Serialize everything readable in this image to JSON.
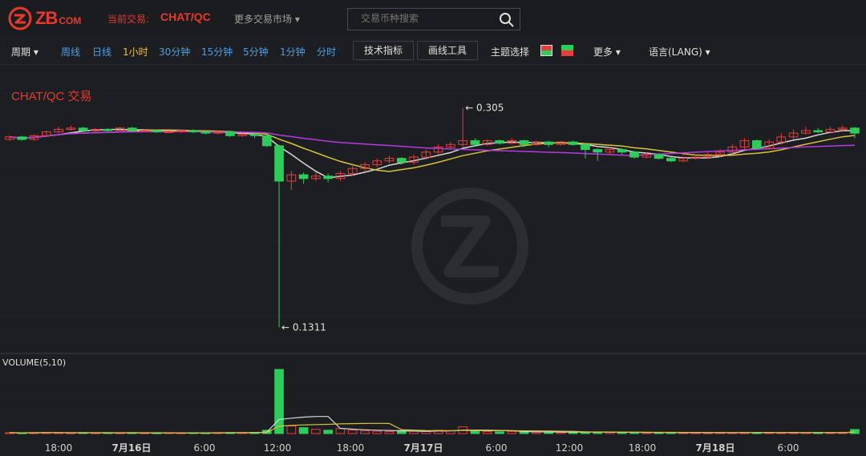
{
  "header": {
    "logo_text": "ZB",
    "logo_sub": "COM",
    "current_label": "当前交易:",
    "current_pair": "CHAT/QC",
    "more_markets": "更多交易市场 ▾",
    "search_placeholder": "交易币种搜索"
  },
  "toolbar": {
    "period": "周期 ▾",
    "intervals": [
      "周线",
      "日线",
      "1小时",
      "30分钟",
      "15分钟",
      "5分钟",
      "1分钟",
      "分时"
    ],
    "active_interval": "1小时",
    "indicators": "技术指标",
    "draw_tools": "画线工具",
    "theme": "主题选择",
    "more": "更多 ▾",
    "language": "语言(LANG) ▾"
  },
  "colors": {
    "up": "#e83d3d",
    "down": "#2ecc5a",
    "ma_white": "#d8d8d8",
    "ma_yellow": "#d9c23a",
    "ma_purple": "#b23adf",
    "accent": "#e63a2f"
  },
  "icons": [
    "zb-logo-icon",
    "search-icon",
    "watermark-logo-icon"
  ],
  "chart_data": {
    "type": "candlestick",
    "title": "CHAT/QC 交易",
    "high_label": "← 0.305",
    "low_label": "← 0.1311",
    "high": 0.305,
    "low": 0.1311,
    "volume_label": "VOLUME(5,10)",
    "x_ticks": [
      "18:00",
      "7月16日",
      "6:00",
      "12:00",
      "18:00",
      "7月17日",
      "6:00",
      "12:00",
      "18:00",
      "7月18日",
      "6:00"
    ],
    "bold_ticks": [
      "7月16日",
      "7月17日",
      "7月18日"
    ],
    "ylim": [
      0.12,
      0.32
    ],
    "candles": [
      [
        0.28,
        0.282,
        0.283,
        0.279
      ],
      [
        0.282,
        0.28,
        0.283,
        0.279
      ],
      [
        0.28,
        0.283,
        0.284,
        0.279
      ],
      [
        0.283,
        0.286,
        0.287,
        0.282
      ],
      [
        0.286,
        0.288,
        0.29,
        0.285
      ],
      [
        0.288,
        0.289,
        0.291,
        0.287
      ],
      [
        0.289,
        0.287,
        0.29,
        0.286
      ],
      [
        0.287,
        0.288,
        0.289,
        0.286
      ],
      [
        0.288,
        0.287,
        0.289,
        0.286
      ],
      [
        0.287,
        0.289,
        0.29,
        0.286
      ],
      [
        0.289,
        0.287,
        0.29,
        0.286
      ],
      [
        0.287,
        0.287,
        0.288,
        0.286
      ],
      [
        0.287,
        0.286,
        0.288,
        0.285
      ],
      [
        0.286,
        0.286,
        0.287,
        0.285
      ],
      [
        0.286,
        0.287,
        0.288,
        0.285
      ],
      [
        0.287,
        0.286,
        0.288,
        0.285
      ],
      [
        0.286,
        0.285,
        0.287,
        0.284
      ],
      [
        0.285,
        0.286,
        0.287,
        0.284
      ],
      [
        0.286,
        0.283,
        0.287,
        0.282
      ],
      [
        0.283,
        0.284,
        0.285,
        0.282
      ],
      [
        0.284,
        0.283,
        0.285,
        0.281
      ],
      [
        0.283,
        0.275,
        0.284,
        0.274
      ],
      [
        0.275,
        0.247,
        0.276,
        0.1311
      ],
      [
        0.247,
        0.252,
        0.255,
        0.24
      ],
      [
        0.252,
        0.249,
        0.254,
        0.245
      ],
      [
        0.249,
        0.251,
        0.254,
        0.247
      ],
      [
        0.251,
        0.249,
        0.253,
        0.246
      ],
      [
        0.249,
        0.253,
        0.255,
        0.247
      ],
      [
        0.253,
        0.257,
        0.259,
        0.251
      ],
      [
        0.257,
        0.26,
        0.262,
        0.255
      ],
      [
        0.26,
        0.263,
        0.265,
        0.258
      ],
      [
        0.263,
        0.265,
        0.267,
        0.261
      ],
      [
        0.265,
        0.262,
        0.266,
        0.26
      ],
      [
        0.262,
        0.266,
        0.268,
        0.26
      ],
      [
        0.266,
        0.27,
        0.272,
        0.264
      ],
      [
        0.27,
        0.274,
        0.276,
        0.268
      ],
      [
        0.274,
        0.276,
        0.278,
        0.272
      ],
      [
        0.276,
        0.279,
        0.305,
        0.274
      ],
      [
        0.279,
        0.276,
        0.281,
        0.275
      ],
      [
        0.276,
        0.279,
        0.28,
        0.275
      ],
      [
        0.279,
        0.277,
        0.28,
        0.276
      ],
      [
        0.277,
        0.279,
        0.281,
        0.276
      ],
      [
        0.279,
        0.276,
        0.28,
        0.274
      ],
      [
        0.276,
        0.278,
        0.279,
        0.275
      ],
      [
        0.278,
        0.276,
        0.279,
        0.274
      ],
      [
        0.276,
        0.278,
        0.279,
        0.275
      ],
      [
        0.278,
        0.276,
        0.279,
        0.275
      ],
      [
        0.276,
        0.272,
        0.277,
        0.265
      ],
      [
        0.272,
        0.27,
        0.273,
        0.263
      ],
      [
        0.27,
        0.272,
        0.274,
        0.268
      ],
      [
        0.272,
        0.27,
        0.273,
        0.268
      ],
      [
        0.27,
        0.266,
        0.271,
        0.265
      ],
      [
        0.266,
        0.268,
        0.27,
        0.265
      ],
      [
        0.268,
        0.265,
        0.269,
        0.264
      ],
      [
        0.265,
        0.263,
        0.266,
        0.262
      ],
      [
        0.263,
        0.265,
        0.267,
        0.262
      ],
      [
        0.265,
        0.266,
        0.268,
        0.264
      ],
      [
        0.266,
        0.268,
        0.27,
        0.265
      ],
      [
        0.268,
        0.27,
        0.272,
        0.266
      ],
      [
        0.27,
        0.274,
        0.276,
        0.268
      ],
      [
        0.274,
        0.279,
        0.281,
        0.272
      ],
      [
        0.279,
        0.273,
        0.28,
        0.272
      ],
      [
        0.273,
        0.278,
        0.28,
        0.272
      ],
      [
        0.278,
        0.282,
        0.285,
        0.276
      ],
      [
        0.282,
        0.285,
        0.288,
        0.28
      ],
      [
        0.285,
        0.287,
        0.29,
        0.284
      ],
      [
        0.287,
        0.286,
        0.289,
        0.285
      ],
      [
        0.286,
        0.288,
        0.29,
        0.285
      ],
      [
        0.288,
        0.289,
        0.291,
        0.286
      ],
      [
        0.289,
        0.285,
        0.29,
        0.281
      ]
    ],
    "volume": [
      0.5,
      0.4,
      0.5,
      0.6,
      0.5,
      0.4,
      0.5,
      0.4,
      0.5,
      0.4,
      0.5,
      0.4,
      0.4,
      0.5,
      0.4,
      0.5,
      0.4,
      0.5,
      0.6,
      0.5,
      0.7,
      2.0,
      38,
      4.5,
      3.5,
      2.5,
      2.0,
      3.0,
      2.0,
      1.6,
      1.4,
      1.2,
      1.8,
      1.4,
      1.2,
      2.0,
      1.6,
      4.0,
      1.5,
      1.2,
      1.0,
      1.2,
      1.0,
      0.8,
      0.9,
      0.7,
      0.8,
      1.0,
      0.8,
      0.7,
      0.6,
      0.7,
      0.6,
      0.5,
      0.6,
      0.5,
      0.6,
      0.5,
      0.6,
      0.5,
      0.6,
      0.7,
      0.6,
      0.5,
      0.6,
      0.5,
      0.6,
      0.5,
      0.6,
      2.4
    ]
  }
}
